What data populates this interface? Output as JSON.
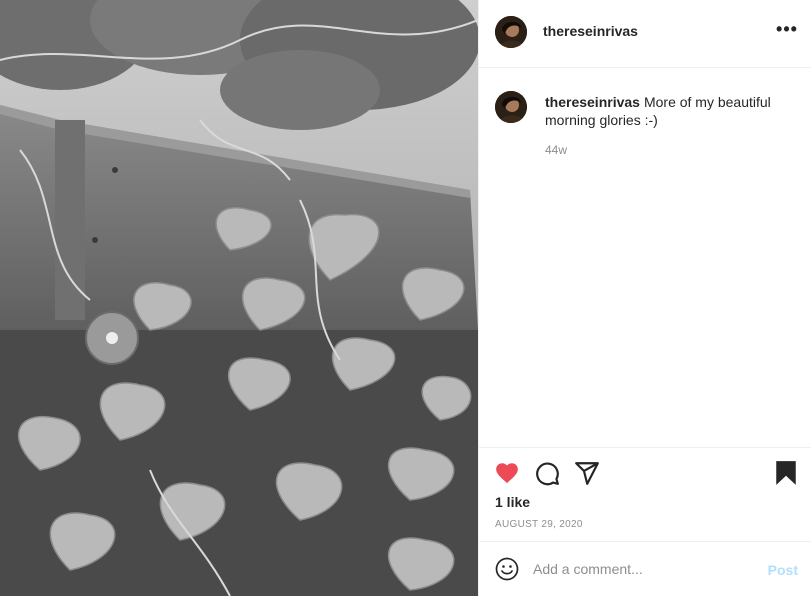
{
  "post": {
    "photo_description_icon": "morning-glory-photo",
    "header": {
      "username": "thereseinrivas",
      "more_icon": "more-horizontal-icon",
      "more_label": "•••"
    },
    "caption": {
      "username": "thereseinrivas",
      "text": "More of my beautiful morning glories :-)",
      "time_ago": "44w"
    },
    "actions": {
      "like_icon": "heart-filled-icon",
      "comment_icon": "comment-icon",
      "share_icon": "share-icon",
      "save_icon": "bookmark-filled-icon",
      "like_color": "#ed4956"
    },
    "likes": "1 like",
    "date": "AUGUST 29, 2020",
    "add_comment": {
      "placeholder": "Add a comment...",
      "post_label": "Post",
      "emoji_icon": "smiley-icon"
    }
  },
  "colors": {
    "border": "#efefef",
    "secondary_text": "#8e8e8e",
    "post_button": "#b2dffc"
  }
}
